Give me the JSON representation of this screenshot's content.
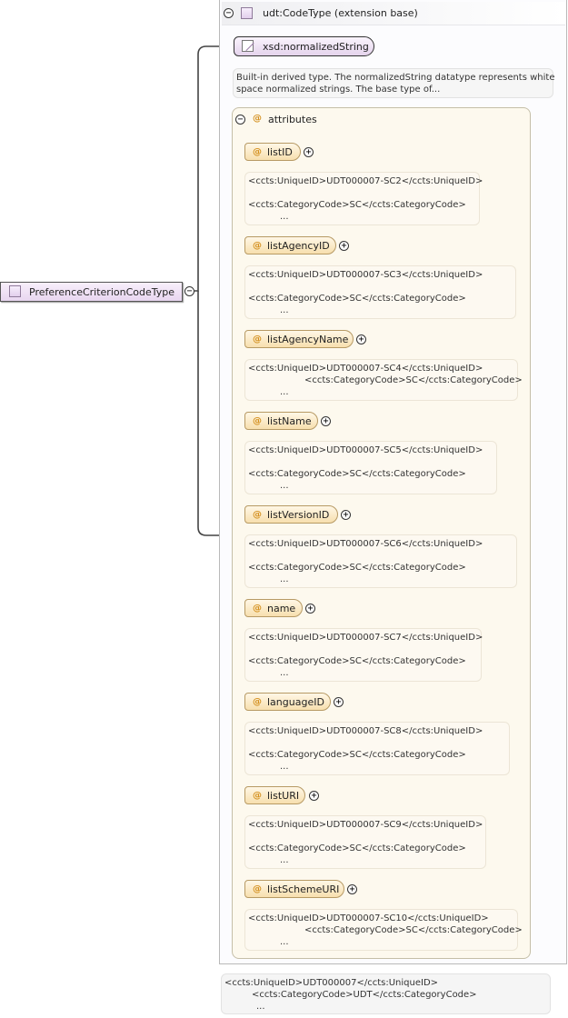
{
  "root": {
    "name": "PreferenceCriterionCodeType"
  },
  "extension": {
    "name": "udt:CodeType",
    "suffix": "(extension base)",
    "base_type": "xsd:normalizedString",
    "base_doc_1": "Built-in derived type. The normalizedString datatype represents white",
    "base_doc_2": "space normalized strings. The base type of..."
  },
  "attributes_group": {
    "label": "attributes"
  },
  "attributes": [
    {
      "name": "listID",
      "l1": "<ccts:UniqueID>UDT000007-SC2</ccts:UniqueID>",
      "l2": "<ccts:CategoryCode>SC</ccts:CategoryCode>",
      "l3": "..."
    },
    {
      "name": "listAgencyID",
      "l1": "<ccts:UniqueID>UDT000007-SC3</ccts:UniqueID>",
      "l2": "<ccts:CategoryCode>SC</ccts:CategoryCode>",
      "l3": "..."
    },
    {
      "name": "listAgencyName",
      "l1": "<ccts:UniqueID>UDT000007-SC4</ccts:UniqueID>",
      "l2": "<ccts:CategoryCode>SC</ccts:CategoryCode>",
      "l3": "..."
    },
    {
      "name": "listName",
      "l1": "<ccts:UniqueID>UDT000007-SC5</ccts:UniqueID>",
      "l2": "<ccts:CategoryCode>SC</ccts:CategoryCode>",
      "l3": "..."
    },
    {
      "name": "listVersionID",
      "l1": "<ccts:UniqueID>UDT000007-SC6</ccts:UniqueID>",
      "l2": "<ccts:CategoryCode>SC</ccts:CategoryCode>",
      "l3": "..."
    },
    {
      "name": "name",
      "l1": "<ccts:UniqueID>UDT000007-SC7</ccts:UniqueID>",
      "l2": "<ccts:CategoryCode>SC</ccts:CategoryCode>",
      "l3": "..."
    },
    {
      "name": "languageID",
      "l1": "<ccts:UniqueID>UDT000007-SC8</ccts:UniqueID>",
      "l2": "<ccts:CategoryCode>SC</ccts:CategoryCode>",
      "l3": "..."
    },
    {
      "name": "listURI",
      "l1": "<ccts:UniqueID>UDT000007-SC9</ccts:UniqueID>",
      "l2": "<ccts:CategoryCode>SC</ccts:CategoryCode>",
      "l3": "..."
    },
    {
      "name": "listSchemeURI",
      "l1": "<ccts:UniqueID>UDT000007-SC10</ccts:UniqueID>",
      "l2": "<ccts:CategoryCode>SC</ccts:CategoryCode>",
      "l3": "..."
    }
  ],
  "type_doc": {
    "l1": "<ccts:UniqueID>UDT000007</ccts:UniqueID>",
    "l2": "<ccts:CategoryCode>UDT</ccts:CategoryCode>",
    "l3": "..."
  }
}
